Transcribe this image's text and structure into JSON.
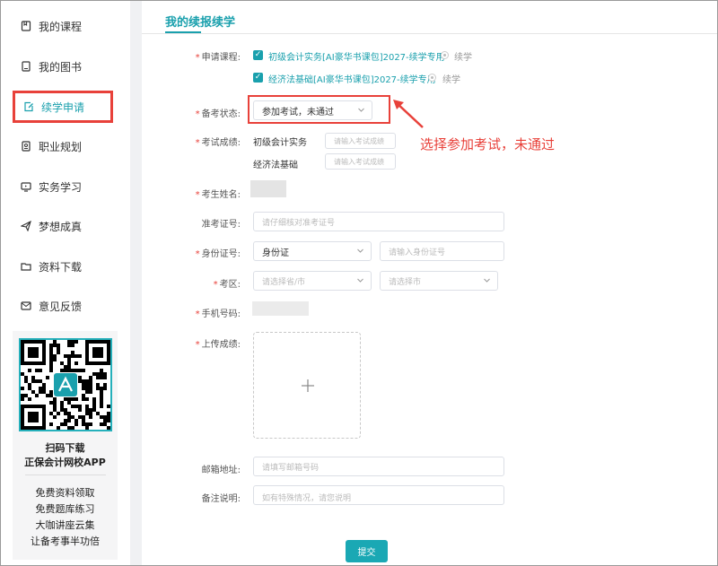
{
  "sidebar": {
    "items": [
      {
        "label": "我的课程",
        "icon": "bookmark-book-icon"
      },
      {
        "label": "我的图书",
        "icon": "book-icon"
      },
      {
        "label": "续学申请",
        "icon": "edit-document-icon",
        "active": true
      },
      {
        "label": "职业规划",
        "icon": "id-card-icon"
      },
      {
        "label": "实务学习",
        "icon": "monitor-icon"
      },
      {
        "label": "梦想成真",
        "icon": "paper-plane-icon"
      },
      {
        "label": "资料下载",
        "icon": "folder-icon"
      },
      {
        "label": "意见反馈",
        "icon": "message-icon"
      }
    ],
    "promo": {
      "line1": "扫码下载",
      "line2": "正保会计网校APP",
      "perks": [
        "免费资料领取",
        "免费题库练习",
        "大咖讲座云集",
        "让备考事半功倍"
      ]
    }
  },
  "main": {
    "tab_title": "我的续报续学",
    "form": {
      "course_label": "申请课程:",
      "courses": [
        {
          "name": "初级会计实务[AI豪华书课包]2027-续学专用",
          "option": "续学",
          "checked": true
        },
        {
          "name": "经济法基础[AI豪华书课包]2027-续学专用",
          "option": "续学",
          "checked": true
        }
      ],
      "exam_status_label": "备考状态:",
      "exam_status_value": "参加考试，未通过",
      "score_label": "考试成绩:",
      "scores": [
        {
          "subject": "初级会计实务",
          "placeholder": "请输入考试成绩"
        },
        {
          "subject": "经济法基础",
          "placeholder": "请输入考试成绩"
        }
      ],
      "name_label": "考生姓名:",
      "ticket_label": "准考证号:",
      "ticket_placeholder": "请仔细核对准考证号",
      "id_label": "身份证号:",
      "id_type_value": "身份证",
      "id_placeholder": "请输入身份证号",
      "area_label": "考区:",
      "province_placeholder": "请选择省/市",
      "city_placeholder": "请选择市",
      "phone_label": "手机号码:",
      "upload_label": "上传成绩:",
      "email_label": "邮箱地址:",
      "email_placeholder": "请填写邮箱号码",
      "note_label": "备注说明:",
      "note_placeholder": "如有特殊情况，请您说明",
      "submit_label": "提交"
    }
  },
  "annotation": {
    "text": "选择参加考试，未通过",
    "color": "#e8413a"
  },
  "colors": {
    "accent": "#1aa0ad",
    "highlight": "#e8413a"
  }
}
